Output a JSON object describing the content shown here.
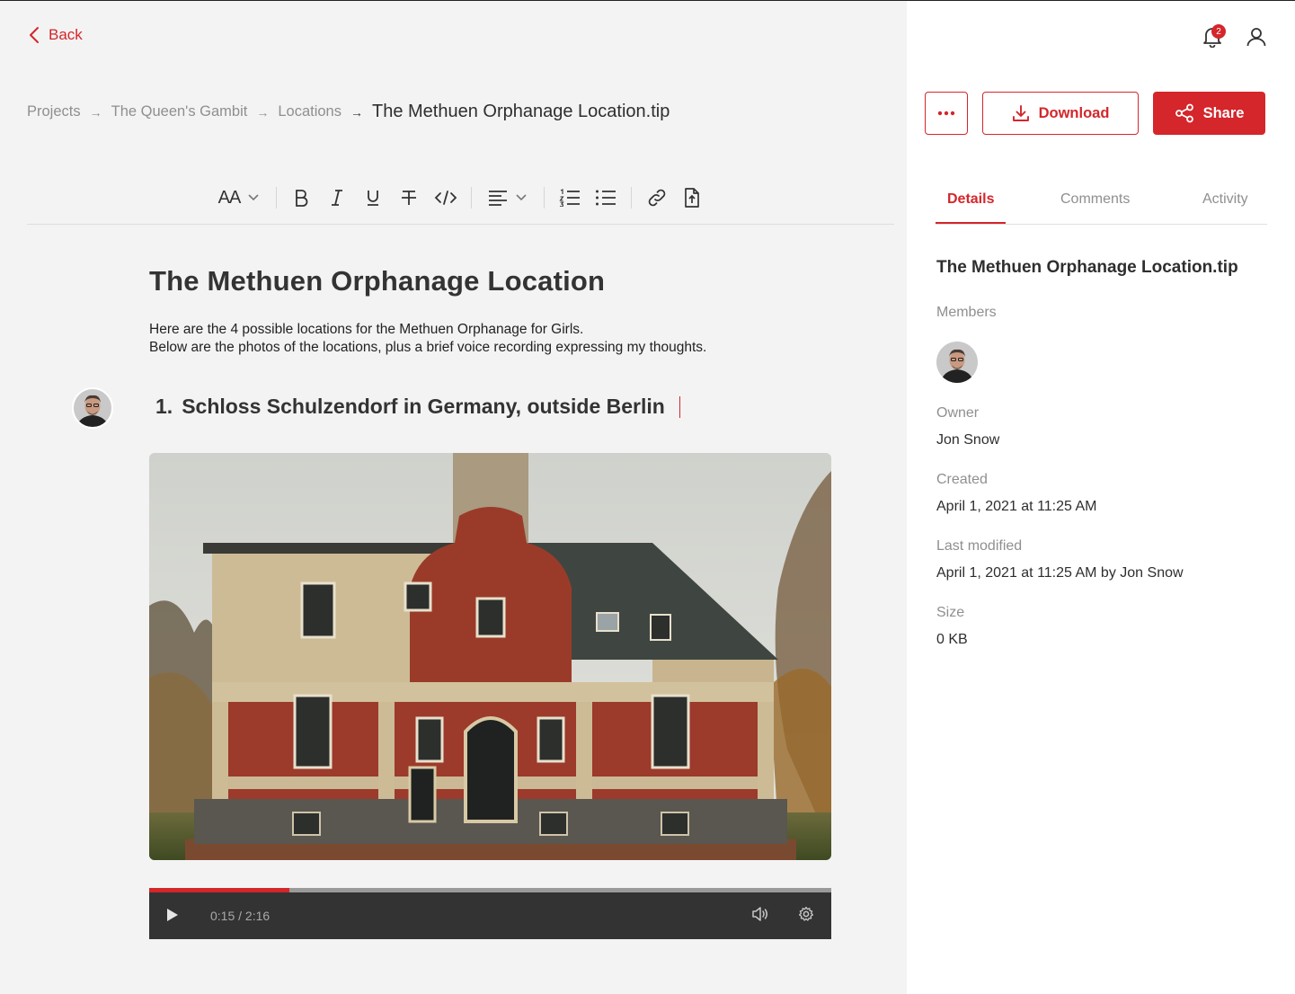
{
  "header": {
    "back_label": "Back"
  },
  "breadcrumb": {
    "items": [
      "Projects",
      "The Queen's Gambit",
      "Locations"
    ],
    "current": "The Methuen Orphanage Location.tip"
  },
  "toolbar": {
    "font_size_label": "AA",
    "tools": [
      "text-size",
      "bold",
      "italic",
      "underline",
      "strikethrough",
      "code",
      "align",
      "numbered-list",
      "bullet-list",
      "link",
      "export"
    ]
  },
  "document": {
    "title": "The Methuen Orphanage Location",
    "paragraph_line1": "Here are the 4 possible locations for the Methuen Orphanage for Girls.",
    "paragraph_line2": "Below are the photos of the locations, plus a brief voice recording expressing my thoughts.",
    "item_number": "1.",
    "item_text": "Schloss Schulzendorf in Germany, outside Berlin"
  },
  "player": {
    "time": "0:15 / 2:16",
    "progress": 0.205
  },
  "topbar": {
    "notification_count": "2"
  },
  "actions": {
    "more_label": "More options",
    "download_label": "Download",
    "share_label": "Share"
  },
  "tabs": [
    "Details",
    "Comments",
    "Activity"
  ],
  "details": {
    "title": "The Methuen Orphanage Location.tip",
    "members_label": "Members",
    "owner_label": "Owner",
    "owner_value": "Jon Snow",
    "created_label": "Created",
    "created_value": "April 1, 2021 at 11:25 AM",
    "modified_label": "Last modified",
    "modified_value": "April 1, 2021 at 11:25 AM by Jon Snow",
    "size_label": "Size",
    "size_value": "0 KB"
  },
  "colors": {
    "accent": "#d4262b",
    "main_bg": "#f3f3f3",
    "player_bg": "#333333"
  }
}
